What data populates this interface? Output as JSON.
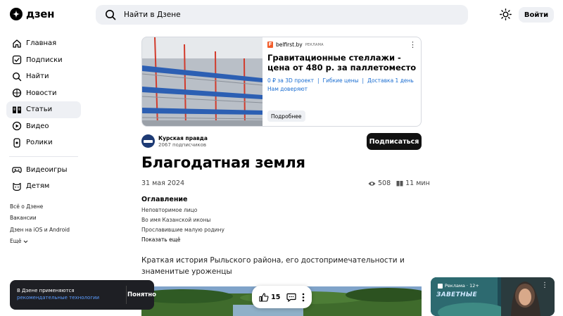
{
  "header": {
    "logo_text": "дзен",
    "search_placeholder": "Найти в Дзене",
    "login_label": "Войти"
  },
  "sidebar": {
    "items": [
      {
        "label": "Главная",
        "icon": "home-icon"
      },
      {
        "label": "Подписки",
        "icon": "subscriptions-icon"
      },
      {
        "label": "Найти",
        "icon": "search-icon"
      },
      {
        "label": "Новости",
        "icon": "news-icon"
      },
      {
        "label": "Статьи",
        "icon": "articles-icon",
        "active": true
      },
      {
        "label": "Видео",
        "icon": "video-icon"
      },
      {
        "label": "Ролики",
        "icon": "shorts-icon"
      }
    ],
    "items2": [
      {
        "label": "Видеоигры",
        "icon": "gamepad-icon"
      },
      {
        "label": "Детям",
        "icon": "kids-icon"
      }
    ],
    "footer_links": [
      "Всё о Дзене",
      "Вакансии",
      "Дзен на iOS и Android",
      "Ещё"
    ]
  },
  "ad": {
    "source": "belfirst.by",
    "tag": "РЕКЛАМА",
    "title": "Гравитационные стеллажи - цена от 480 р. за паллетоместо",
    "links": [
      "0 ₽ за 3D проект",
      "Гибкие цены",
      "Доставка 1 день",
      "Нам доверяют"
    ],
    "more_label": "Подробнее"
  },
  "channel": {
    "name": "Курская правда",
    "subscribers": "2067 подписчиков",
    "subscribe_label": "Подписаться"
  },
  "article": {
    "title": "Благодатная земля",
    "date": "31 мая 2024",
    "views": "508",
    "read_time": "11 мин",
    "toc_title": "Оглавление",
    "toc_items": [
      "Неповторимое лицо",
      "Во имя Казанской иконы",
      "Прославившие малую родину"
    ],
    "toc_more": "Показать ещё",
    "lead": "Краткая история Рыльского района, его достопримечательности и знаменитые уроженцы",
    "likes": "15"
  },
  "cookie": {
    "text": "В Дзене применяются",
    "link": "рекомендательные технологии",
    "button": "Понятно"
  },
  "side_ad": {
    "label": "Реклама · 12+",
    "logo": "ЗАВЕТНЫЕ"
  },
  "colors": {
    "accent": "#1a6dd1",
    "surface": "#eef0f4",
    "dark": "#111111"
  }
}
